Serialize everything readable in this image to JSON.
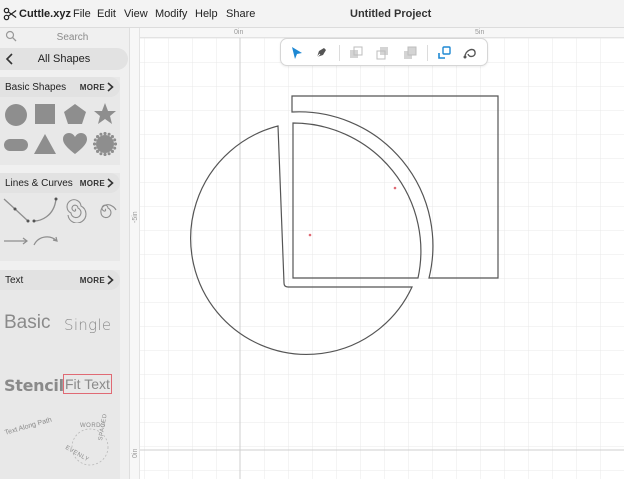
{
  "app": {
    "logo_icon": "scissors-icon",
    "name": "Cuttle.xyz",
    "project_title": "Untitled Project"
  },
  "menu": [
    {
      "label": "File"
    },
    {
      "label": "Edit"
    },
    {
      "label": "View"
    },
    {
      "label": "Modify"
    },
    {
      "label": "Help"
    },
    {
      "label": "Share"
    }
  ],
  "sidebar": {
    "search": {
      "placeholder": "Search",
      "icon": "search-icon"
    },
    "all_shapes": {
      "label": "All Shapes",
      "icon": "chevron-left-icon"
    },
    "panels": {
      "basic": {
        "title": "Basic Shapes",
        "more": "MORE",
        "shapes": [
          "circle-icon",
          "square-icon",
          "pentagon-icon",
          "star-icon",
          "rounded-rect-icon",
          "triangle-icon",
          "heart-icon",
          "gear-icon"
        ]
      },
      "lines": {
        "title": "Lines & Curves",
        "more": "MORE",
        "shapes": [
          "polyline-icon",
          "curve-icon",
          "spiral-icon",
          "spiral-icon",
          "arrow-icon",
          "arc-arrow-icon"
        ]
      },
      "text": {
        "title": "Text",
        "more": "MORE",
        "samples": {
          "basic": "Basic",
          "single": "Single",
          "stencil": "Stencil",
          "fit_text": "Fit Text",
          "text_along_path": "Text Along Path",
          "words_top": "WORDS",
          "evenly": "EVENLY",
          "spaced": "SPACED"
        }
      }
    }
  },
  "canvas": {
    "ruler": {
      "top_0": "0in",
      "top_5": "5in",
      "left_5": "-5in",
      "left_0": "0in"
    },
    "toolbar": {
      "tools": [
        "select-arrow-icon",
        "pen-icon",
        "layer-back-icon",
        "layer-down-icon",
        "layer-up-icon",
        "link-icon",
        "node-edit-icon"
      ]
    }
  },
  "colors": {
    "accent": "#1e88d3",
    "grid": "#e8e8e8",
    "shape_stroke": "#555555",
    "fit_text_border": "#e06a74"
  }
}
